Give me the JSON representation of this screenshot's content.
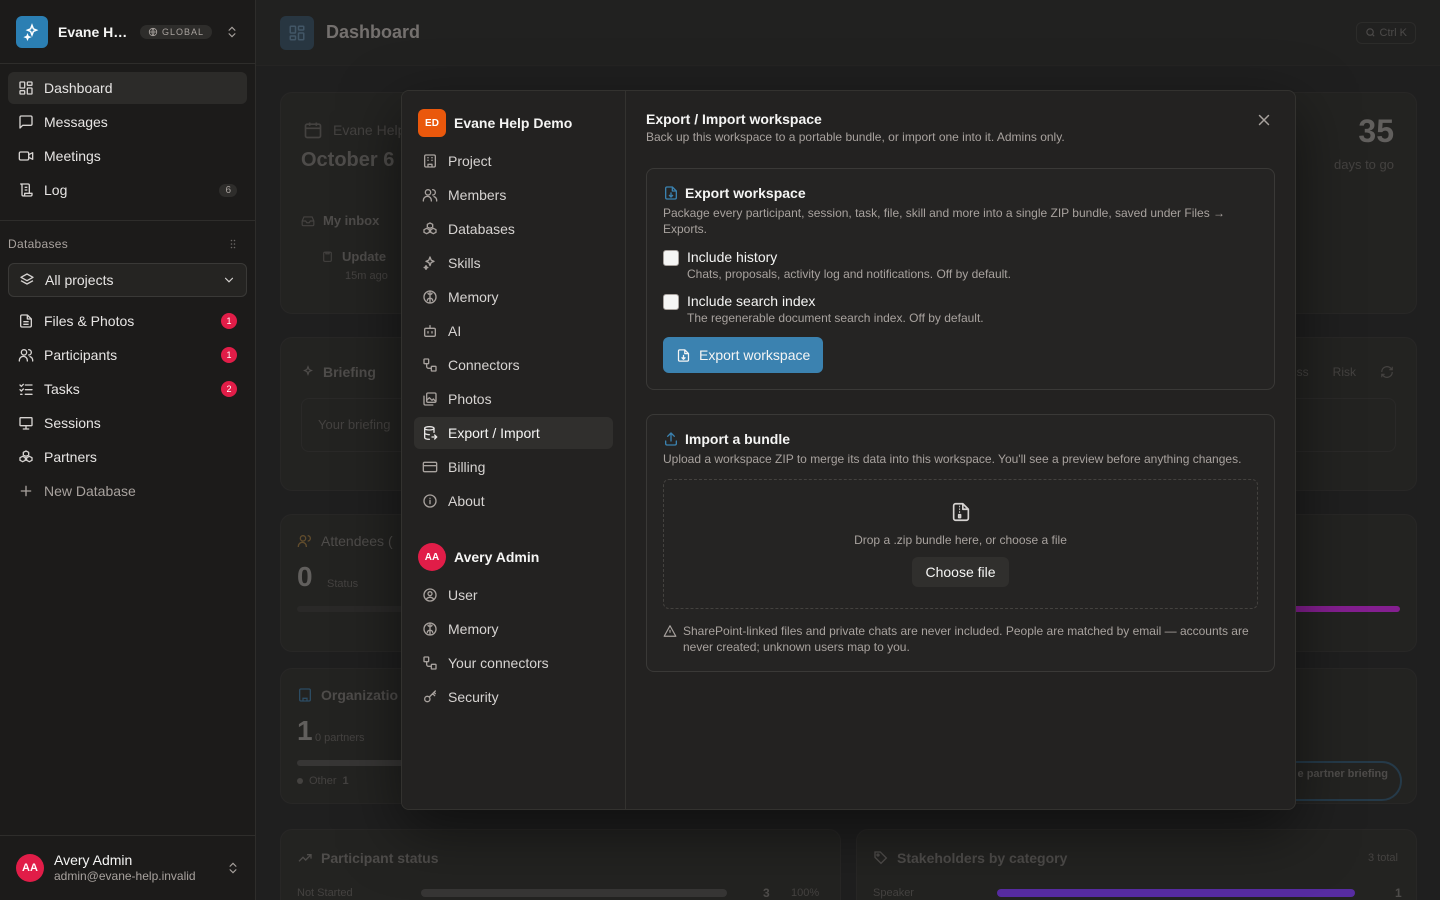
{
  "workspace": {
    "name": "Evane Help Demo",
    "short_name": "Evane Help Demo",
    "badge": "GLOBAL"
  },
  "sidebar": {
    "items": [
      {
        "label": "Dashboard"
      },
      {
        "label": "Messages"
      },
      {
        "label": "Meetings"
      },
      {
        "label": "Log",
        "count": "6"
      }
    ],
    "databases_label": "Databases",
    "project_select": "All projects",
    "db_items": [
      {
        "label": "Files & Photos",
        "badge": "1"
      },
      {
        "label": "Participants",
        "badge": "1"
      },
      {
        "label": "Tasks",
        "badge": "2"
      },
      {
        "label": "Sessions"
      },
      {
        "label": "Partners"
      }
    ],
    "new_database": "New Database"
  },
  "user": {
    "initials": "AA",
    "name": "Avery Admin",
    "email": "admin@evane-help.invalid"
  },
  "topbar": {
    "title": "Dashboard",
    "shortcut": "Ctrl K"
  },
  "background": {
    "event_name": "Evane Help",
    "event_date": "October 6",
    "countdown_value": "35",
    "countdown_label": "days to go",
    "inbox_title": "My inbox",
    "inbox_item": "Update",
    "inbox_time": "15m ago",
    "briefing_title": "Briefing",
    "briefing_placeholder": "Your briefing",
    "briefing_tabs": [
      "ss",
      "Risk"
    ],
    "attendees_title": "Attendees (",
    "attendees_value": "0",
    "attendees_status": "Status",
    "org_title": "Organizatio",
    "org_value": "1",
    "org_sub": "0 partners",
    "org_legend": "Other",
    "org_legend_value": "1",
    "partner_briefing": "e partner briefing",
    "participant_status_title": "Participant status",
    "status_row_label": "Not Started",
    "status_row_value": "3",
    "status_row_pct": "100%",
    "stakeholders_title": "Stakeholders by category",
    "stakeholders_total": "3 total",
    "stake_row_label": "Speaker",
    "stake_row_value": "1"
  },
  "modal": {
    "workspace_initials": "ED",
    "workspace_name": "Evane Help Demo",
    "workspace_nav": [
      {
        "label": "Project",
        "icon": "building-icon"
      },
      {
        "label": "Members",
        "icon": "users-icon"
      },
      {
        "label": "Databases",
        "icon": "boxes-icon"
      },
      {
        "label": "Skills",
        "icon": "sparkles-icon"
      },
      {
        "label": "Memory",
        "icon": "brain-icon"
      },
      {
        "label": "AI",
        "icon": "bot-icon"
      },
      {
        "label": "Connectors",
        "icon": "workflow-icon"
      },
      {
        "label": "Photos",
        "icon": "images-icon"
      },
      {
        "label": "Export / Import",
        "icon": "database-export-icon"
      },
      {
        "label": "Billing",
        "icon": "credit-card-icon"
      },
      {
        "label": "About",
        "icon": "info-icon"
      }
    ],
    "user_initials": "AA",
    "user_name": "Avery Admin",
    "user_nav": [
      {
        "label": "User"
      },
      {
        "label": "Memory"
      },
      {
        "label": "Your connectors"
      },
      {
        "label": "Security"
      }
    ],
    "title": "Export / Import workspace",
    "subtitle": "Back up this workspace to a portable bundle, or import one into it. Admins only.",
    "export": {
      "title": "Export workspace",
      "description": "Package every participant, session, task, file, skill and more into a single ZIP bundle, saved under Files → Exports.",
      "option1_label": "Include history",
      "option1_desc": "Chats, proposals, activity log and notifications. Off by default.",
      "option2_label": "Include search index",
      "option2_desc": "The regenerable document search index. Off by default.",
      "button": "Export workspace"
    },
    "import": {
      "title": "Import a bundle",
      "description": "Upload a workspace ZIP to merge its data into this workspace. You'll see a preview before anything changes.",
      "drop_text": "Drop a .zip bundle here, or choose a file",
      "choose_button": "Choose file",
      "note": "SharePoint-linked files and private chats are never included. People are matched by email — accounts are never created; unknown users map to you."
    }
  },
  "colors": {
    "accent": "#3b82b0",
    "badge": "#e11d48",
    "workspace": "#ea580c",
    "progress": "#c026d3"
  }
}
